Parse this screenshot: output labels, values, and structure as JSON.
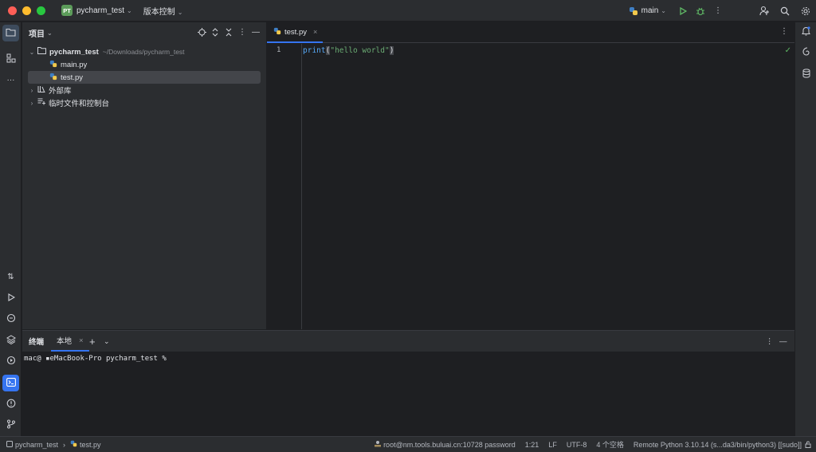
{
  "titlebar": {
    "project_badge": "PT",
    "project_name": "pycharm_test",
    "vcs_menu": "版本控制",
    "run_config": "main",
    "colors": {
      "badge_bg": "#5c9c5a",
      "close": "#ff5f57",
      "minimize": "#febc2e",
      "zoom": "#28c840"
    }
  },
  "project_panel": {
    "title": "项目",
    "root": {
      "name": "pycharm_test",
      "path": "~/Downloads/pycharm_test"
    },
    "files": [
      "main.py",
      "test.py"
    ],
    "selected_file": "test.py",
    "nodes": [
      "外部库",
      "临时文件和控制台"
    ]
  },
  "editor": {
    "tab_label": "test.py",
    "line_number": "1",
    "code": {
      "fn": "print",
      "open": "(",
      "str": "\"hello world\"",
      "close": ")"
    }
  },
  "terminal": {
    "title": "终端",
    "tab_label": "本地",
    "prompt": "mac@ ▪eMacBook-Pro pycharm_test %"
  },
  "statusbar": {
    "breadcrumb_project": "pycharm_test",
    "breadcrumb_file": "test.py",
    "remote": "root@nm.tools.buluai.cn:10728 password",
    "position": "1:21",
    "line_ending": "LF",
    "encoding": "UTF-8",
    "indent": "4 个空格",
    "interpreter": "Remote Python 3.10.14 (s...da3/bin/python3) [[sudo]]"
  }
}
